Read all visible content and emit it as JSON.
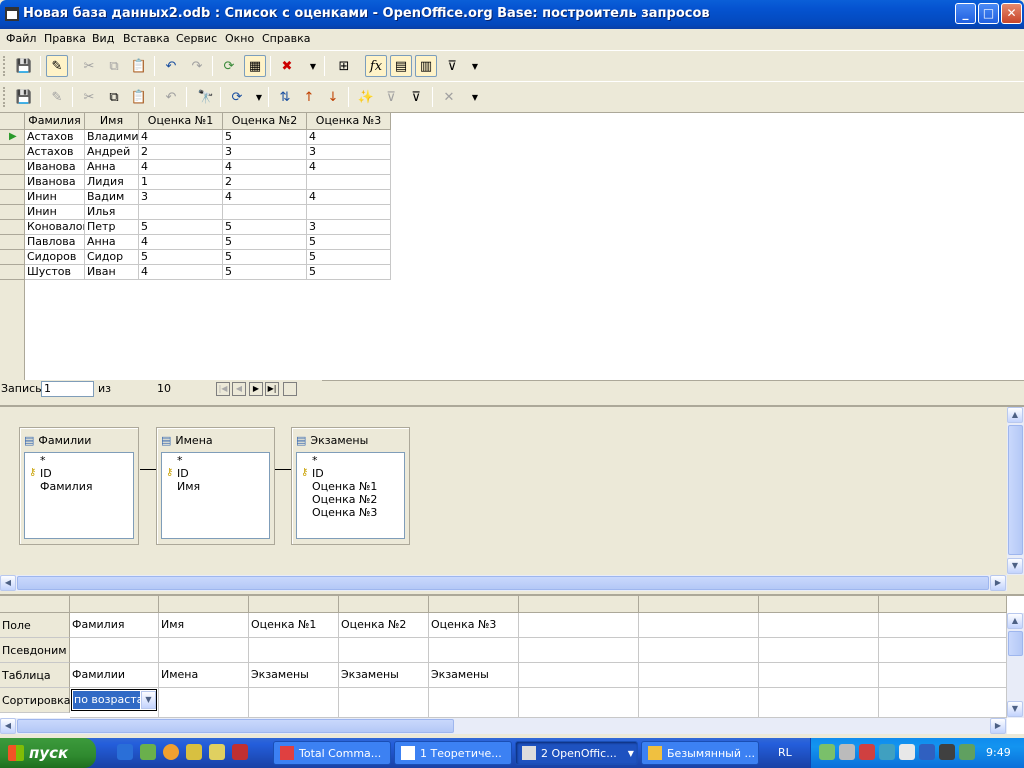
{
  "window": {
    "title": "Новая база данных2.odb : Список с оценками - OpenOffice.org Base: построитель запросов",
    "min": "_",
    "max": "□",
    "close": "✕"
  },
  "menu": [
    "Файл",
    "Правка",
    "Вид",
    "Вставка",
    "Сервис",
    "Окно",
    "Справка"
  ],
  "grid": {
    "headers": [
      "Фамилия",
      "Имя",
      "Оценка №1",
      "Оценка №2",
      "Оценка №3"
    ],
    "rows": [
      [
        "Астахов",
        "Владимир",
        "4",
        "5",
        "4"
      ],
      [
        "Астахов",
        "Андрей",
        "2",
        "3",
        "3"
      ],
      [
        "Иванова",
        "Анна",
        "4",
        "4",
        "4"
      ],
      [
        "Иванова",
        "Лидия",
        "1",
        "2",
        ""
      ],
      [
        "Инин",
        "Вадим",
        "3",
        "4",
        "4"
      ],
      [
        "Инин",
        "Илья",
        "",
        "",
        ""
      ],
      [
        "Коновалов",
        "Петр",
        "5",
        "5",
        "3"
      ],
      [
        "Павлова",
        "Анна",
        "4",
        "5",
        "5"
      ],
      [
        "Сидоров",
        "Сидор",
        "5",
        "5",
        "5"
      ],
      [
        "Шустов",
        "Иван",
        "4",
        "5",
        "5"
      ]
    ]
  },
  "nav": {
    "record_label": "Запись",
    "record_value": "1",
    "of_label": "из",
    "total": "10"
  },
  "tables": [
    {
      "name": "Фамилии",
      "fields": [
        "*",
        "ID",
        "Фамилия"
      ]
    },
    {
      "name": "Имена",
      "fields": [
        "*",
        "ID",
        "Имя"
      ]
    },
    {
      "name": "Экзамены",
      "fields": [
        "*",
        "ID",
        "Оценка №1",
        "Оценка №2",
        "Оценка №3"
      ]
    }
  ],
  "query": {
    "row_labels": [
      "Поле",
      "Псевдоним",
      "Таблица",
      "Сортировка"
    ],
    "fields": [
      "Фамилия",
      "Имя",
      "Оценка №1",
      "Оценка №2",
      "Оценка №3"
    ],
    "tables": [
      "Фамилии",
      "Имена",
      "Экзамены",
      "Экзамены",
      "Экзамены"
    ],
    "sort_value": "по возрастан"
  },
  "taskbar": {
    "start": "пуск",
    "tasks": [
      "Total Comma...",
      "1 Теоретиче...",
      "2 OpenOffic...",
      "Безымянный ..."
    ],
    "lang": "RL",
    "clock": "9:49"
  }
}
